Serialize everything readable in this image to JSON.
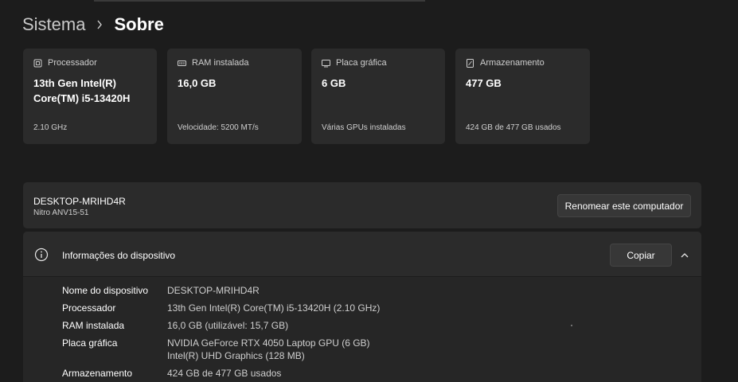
{
  "breadcrumb": {
    "parent": "Sistema",
    "current": "Sobre"
  },
  "specs": [
    {
      "icon": "processor-icon",
      "label": "Processador",
      "value": "13th Gen Intel(R)\nCore(TM) i5-13420H",
      "sub": "2.10 GHz"
    },
    {
      "icon": "memory-icon",
      "label": "RAM instalada",
      "value": "16,0 GB",
      "sub": "Velocidade: 5200 MT/s"
    },
    {
      "icon": "graphics-card-icon",
      "label": "Placa gráfica",
      "value": "6 GB",
      "sub": "Várias GPUs instaladas"
    },
    {
      "icon": "storage-icon",
      "label": "Armazenamento",
      "value": "477 GB",
      "sub": "424 GB de 477 GB usados"
    }
  ],
  "device": {
    "name": "DESKTOP-MRIHD4R",
    "model": "Nitro ANV15-51",
    "rename_label": "Renomear este computador"
  },
  "info": {
    "title": "Informações do dispositivo",
    "copy_label": "Copiar",
    "rows": [
      {
        "label": "Nome do dispositivo",
        "value": "DESKTOP-MRIHD4R"
      },
      {
        "label": "Processador",
        "value": "13th Gen Intel(R) Core(TM) i5-13420H (2.10 GHz)"
      },
      {
        "label": "RAM instalada",
        "value": "16,0 GB (utilizável: 15,7 GB)"
      },
      {
        "label": "Placa gráfica",
        "value": "NVIDIA GeForce RTX 4050 Laptop GPU (6 GB)\nIntel(R) UHD Graphics (128 MB)"
      },
      {
        "label": "Armazenamento",
        "value": "424 GB de 477 GB usados"
      }
    ]
  }
}
